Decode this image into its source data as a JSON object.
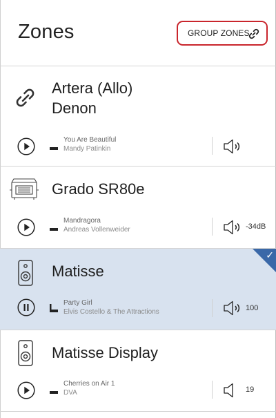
{
  "header": {
    "title": "Zones",
    "group_label": "GROUP ZONES"
  },
  "zones": [
    {
      "name": "Artera (Allo)\nDenon",
      "song": "You Are Beautiful",
      "artist": "Mandy Patinkin",
      "volume": "",
      "state": "stopped",
      "icon": "link-icon",
      "selected": false
    },
    {
      "name": "Grado SR80e",
      "song": "Mandragora",
      "artist": "Andreas Vollenweider",
      "volume": "-34dB",
      "state": "stopped",
      "icon": "device-icon",
      "selected": false
    },
    {
      "name": "Matisse",
      "song": "Party Girl",
      "artist": "Elvis Costello & The Attractions",
      "volume": "100",
      "state": "playing",
      "icon": "speaker-icon",
      "selected": true,
      "check": "✓"
    },
    {
      "name": "Matisse Display",
      "song": "Cherries on Air 1",
      "artist": "DVA",
      "volume": "19",
      "state": "stopped",
      "icon": "speaker-icon",
      "selected": false
    }
  ],
  "colors": {
    "accent_red": "#c9252c",
    "selected_bg": "#d8e2ef",
    "check_blue": "#3a68a8"
  }
}
